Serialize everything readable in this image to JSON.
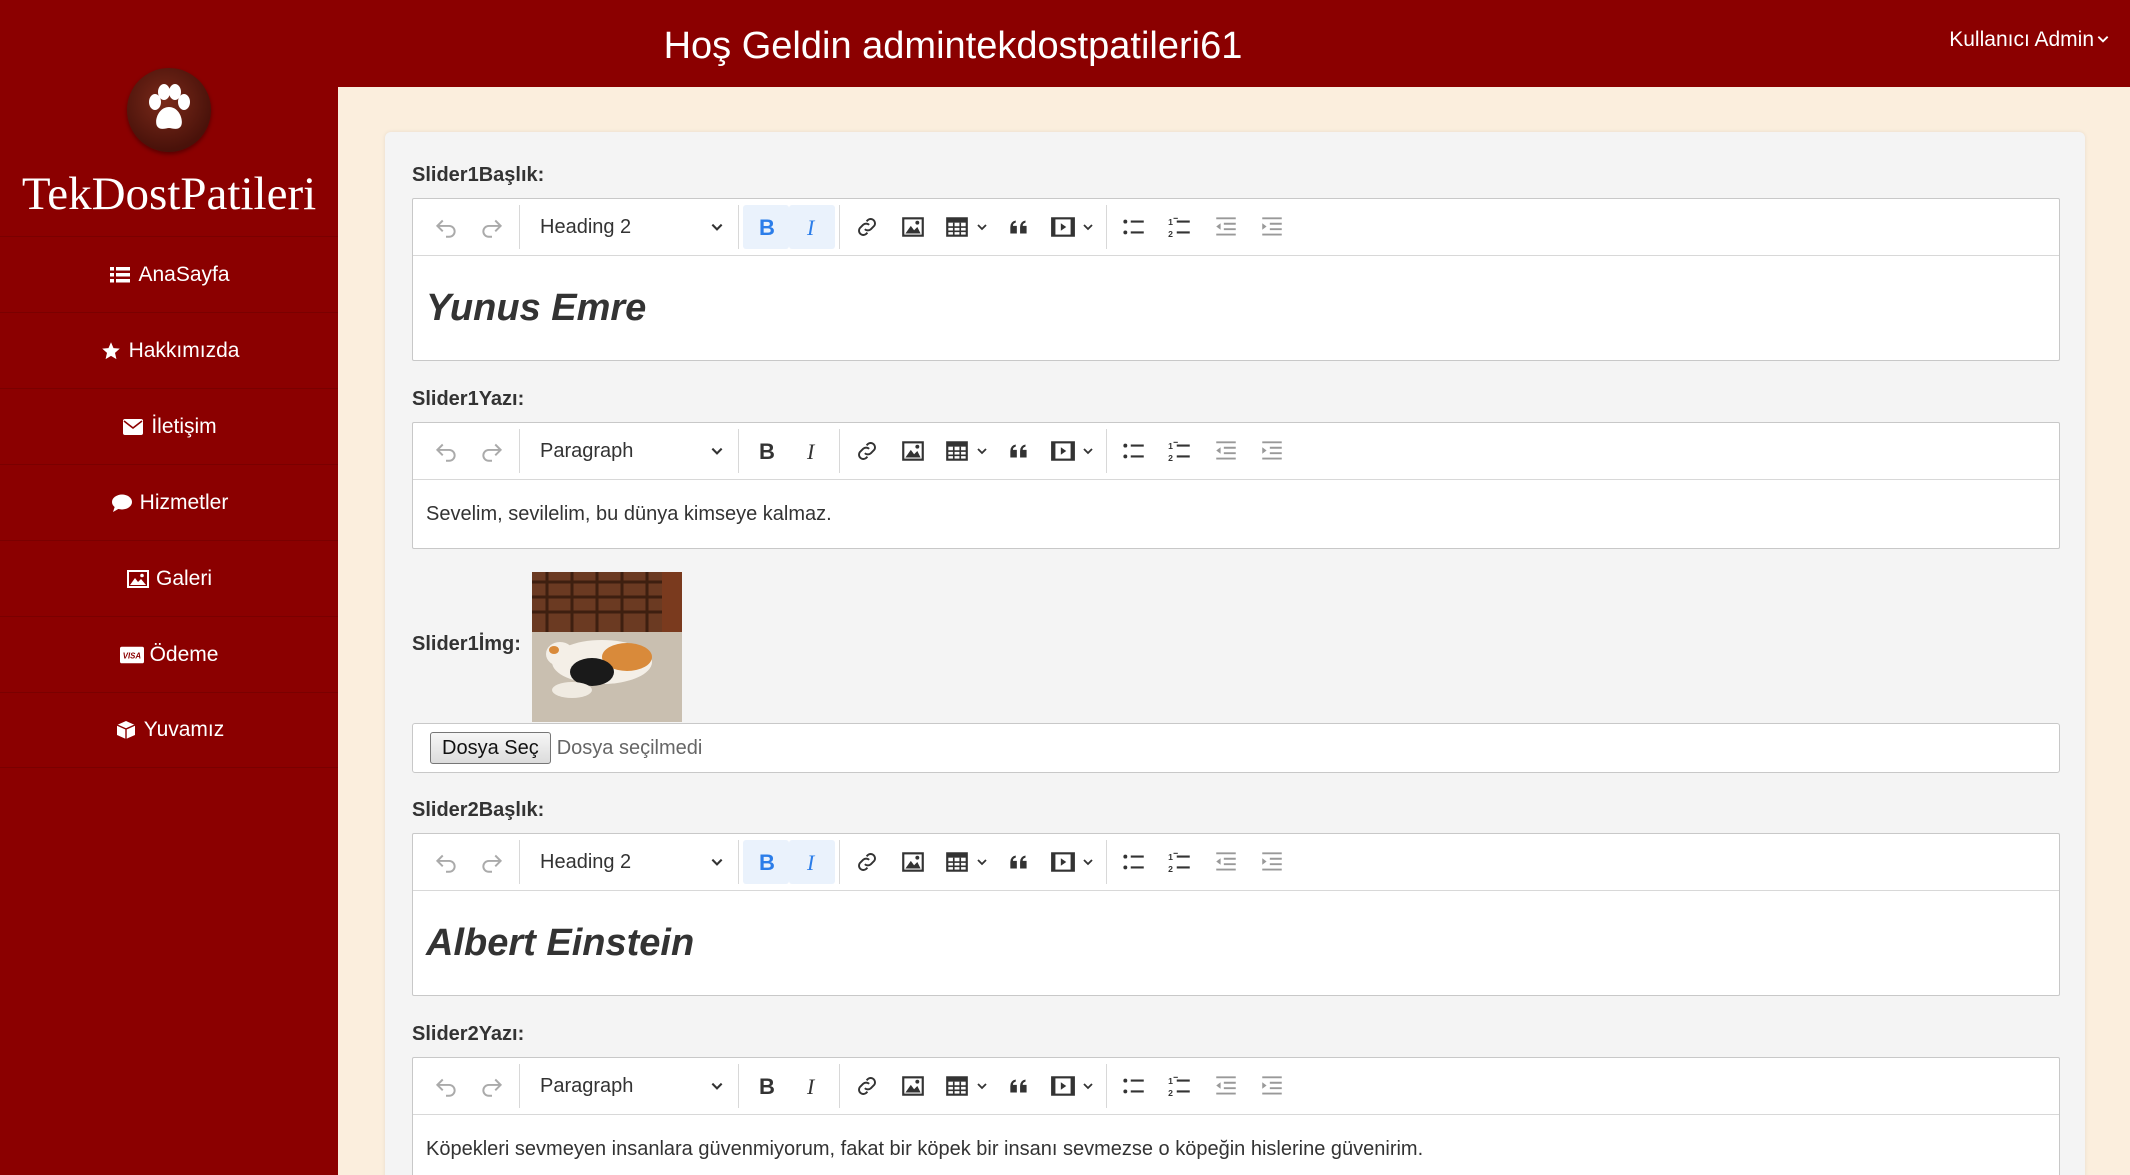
{
  "header": {
    "welcome": "Hoş Geldin admintekdostpatileri61",
    "user_menu": "Kullanıcı Admin"
  },
  "sidebar": {
    "brand": "TekDostPatileri",
    "items": [
      {
        "label": "AnaSayfa",
        "icon": "list-icon"
      },
      {
        "label": "Hakkımızda",
        "icon": "star-icon"
      },
      {
        "label": "İletişim",
        "icon": "envelope-icon"
      },
      {
        "label": "Hizmetler",
        "icon": "comment-icon"
      },
      {
        "label": "Galeri",
        "icon": "image-icon"
      },
      {
        "label": "Ödeme",
        "icon": "visa-card-icon"
      },
      {
        "label": "Yuvamız",
        "icon": "cube-icon"
      }
    ]
  },
  "form": {
    "slider1_title": {
      "label": "Slider1Başlık:",
      "format": "Heading 2",
      "content": "Yunus Emre"
    },
    "slider1_text": {
      "label": "Slider1Yazı:",
      "format": "Paragraph",
      "content": "Sevelim, sevilelim, bu dünya kimseye kalmaz."
    },
    "slider1_img": {
      "label": "Slider1İmg:",
      "file_button": "Dosya Seç",
      "file_status": "Dosya seçilmedi"
    },
    "slider2_title": {
      "label": "Slider2Başlık:",
      "format": "Heading 2",
      "content": "Albert Einstein"
    },
    "slider2_text": {
      "label": "Slider2Yazı:",
      "format": "Paragraph",
      "content": "Köpekleri sevmeyen insanlara güvenmiyorum, fakat bir köpek bir insanı sevmezse o köpeğin hislerine güvenirim."
    }
  },
  "colors": {
    "primary": "#8b0000",
    "background": "#fbeedd",
    "active_tool": "#2b7de9"
  }
}
